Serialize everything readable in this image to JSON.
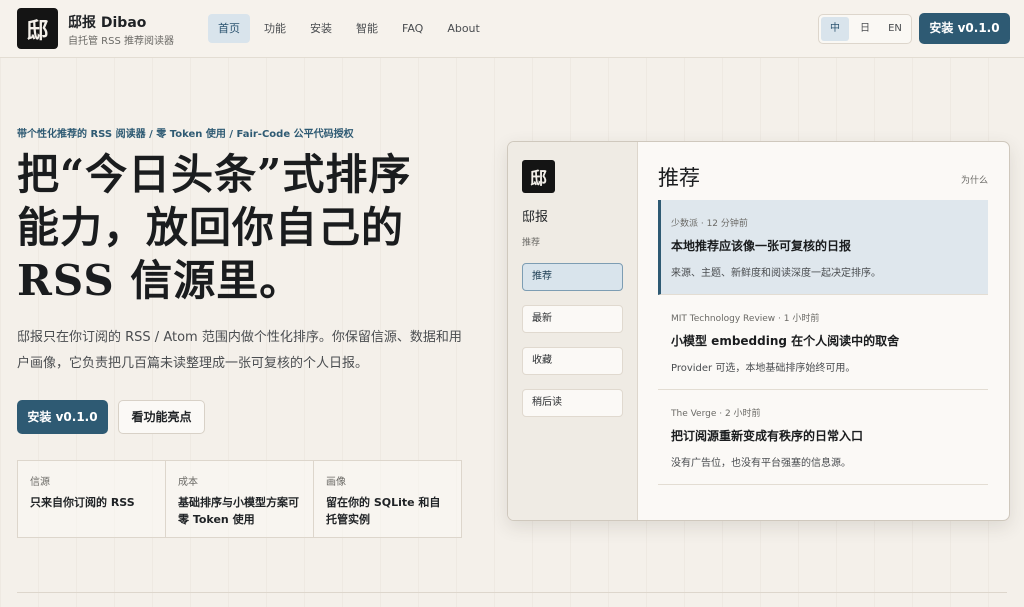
{
  "header": {
    "logo_glyph": "邸",
    "brand_name": "邸报 Dibao",
    "brand_sub": "自托管 RSS 推荐阅读器",
    "nav": [
      {
        "label": "首页",
        "active": true
      },
      {
        "label": "功能",
        "active": false
      },
      {
        "label": "安装",
        "active": false
      },
      {
        "label": "智能",
        "active": false
      },
      {
        "label": "FAQ",
        "active": false
      },
      {
        "label": "About",
        "active": false
      }
    ],
    "languages": [
      {
        "label": "中",
        "active": true
      },
      {
        "label": "日",
        "active": false
      },
      {
        "label": "EN",
        "active": false
      }
    ],
    "install_label": "安装 v0.1.0"
  },
  "hero": {
    "eyebrow": "带个性化推荐的 RSS 阅读器 / 零 Token 使用 / Fair-Code 公平代码授权",
    "headline_line1": "把“今日头条”式排序",
    "headline_line2": "能力，放回你自己的",
    "headline_line3": "RSS 信源里。",
    "lede": "邸报只在你订阅的 RSS / Atom 范围内做个性化排序。你保留信源、数据和用户画像，它负责把几百篇未读整理成一张可复核的个人日报。",
    "primary_button": "安装 v0.1.0",
    "secondary_button": "看功能亮点",
    "features": [
      {
        "label": "信源",
        "value": "只来自你订阅的 RSS"
      },
      {
        "label": "成本",
        "value": "基础排序与小模型方案可零 Token 使用"
      },
      {
        "label": "画像",
        "value": "留在你的 SQLite 和自托管实例"
      }
    ]
  },
  "preview": {
    "logo_glyph": "邸",
    "app_name": "邸报",
    "section_label": "推荐",
    "sidebar": [
      {
        "label": "推荐",
        "active": true
      },
      {
        "label": "最新",
        "active": false
      },
      {
        "label": "收藏",
        "active": false
      },
      {
        "label": "稍后读",
        "active": false
      }
    ],
    "title": "推荐",
    "why_label": "为什么",
    "cards": [
      {
        "meta": "少数派 · 12 分钟前",
        "title": "本地推荐应该像一张可复核的日报",
        "desc": "来源、主题、新鲜度和阅读深度一起决定排序。",
        "active": true
      },
      {
        "meta": "MIT Technology Review · 1 小时前",
        "title": "小模型 embedding 在个人阅读中的取舍",
        "desc": "Provider 可选，本地基础排序始终可用。",
        "active": false
      },
      {
        "meta": "The Verge · 2 小时前",
        "title": "把订阅源重新变成有秩序的日常入口",
        "desc": "没有广告位，也没有平台强塞的信息源。",
        "active": false
      }
    ]
  },
  "colors": {
    "accent": "#2e5a73",
    "accent_soft": "#d9e4ec",
    "background": "#f4f0ea"
  }
}
